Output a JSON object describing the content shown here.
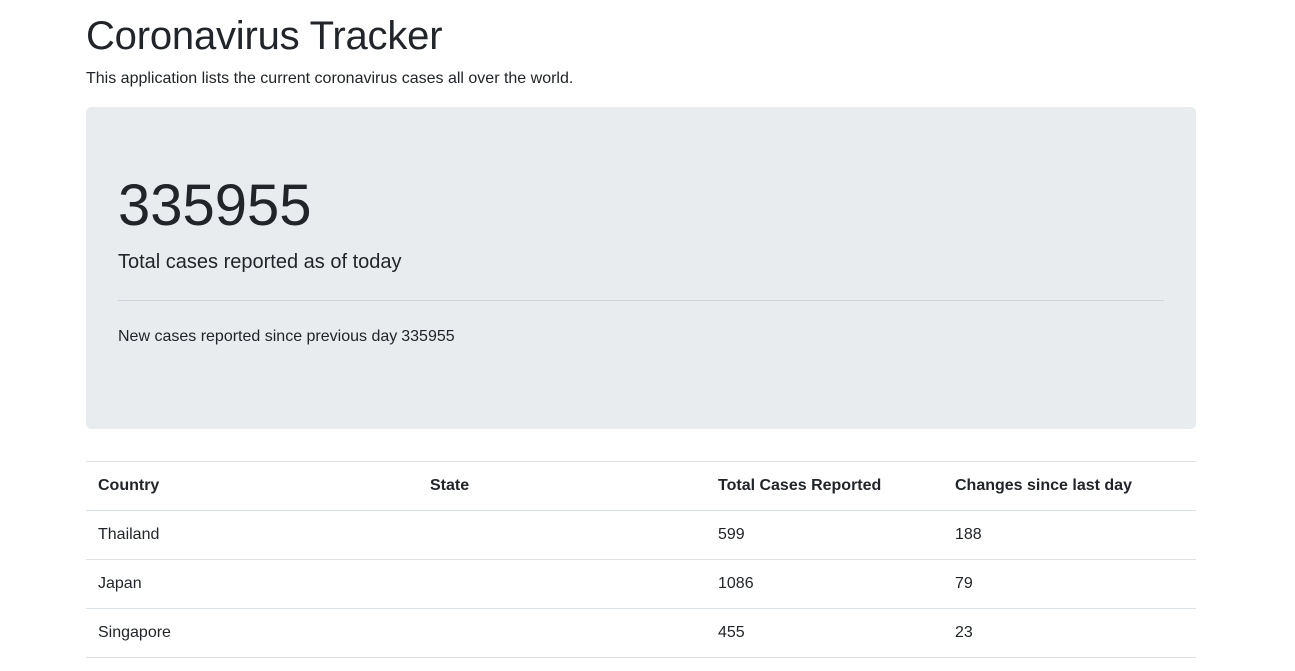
{
  "header": {
    "title": "Coronavirus Tracker",
    "subtitle": "This application lists the current coronavirus cases all over the world."
  },
  "summary": {
    "total_cases": "335955",
    "total_label": "Total cases reported as of today",
    "new_cases_label": "New cases reported since previous day",
    "new_cases_value": "335955"
  },
  "table": {
    "columns": [
      "Country",
      "State",
      "Total Cases Reported",
      "Changes since last day"
    ],
    "rows": [
      {
        "country": "Thailand",
        "state": "",
        "total": "599",
        "change": "188"
      },
      {
        "country": "Japan",
        "state": "",
        "total": "1086",
        "change": "79"
      },
      {
        "country": "Singapore",
        "state": "",
        "total": "455",
        "change": "23"
      }
    ]
  },
  "colors": {
    "jumbotron_bg": "#e9ecef",
    "text": "#212529",
    "border": "#dee2e6"
  }
}
